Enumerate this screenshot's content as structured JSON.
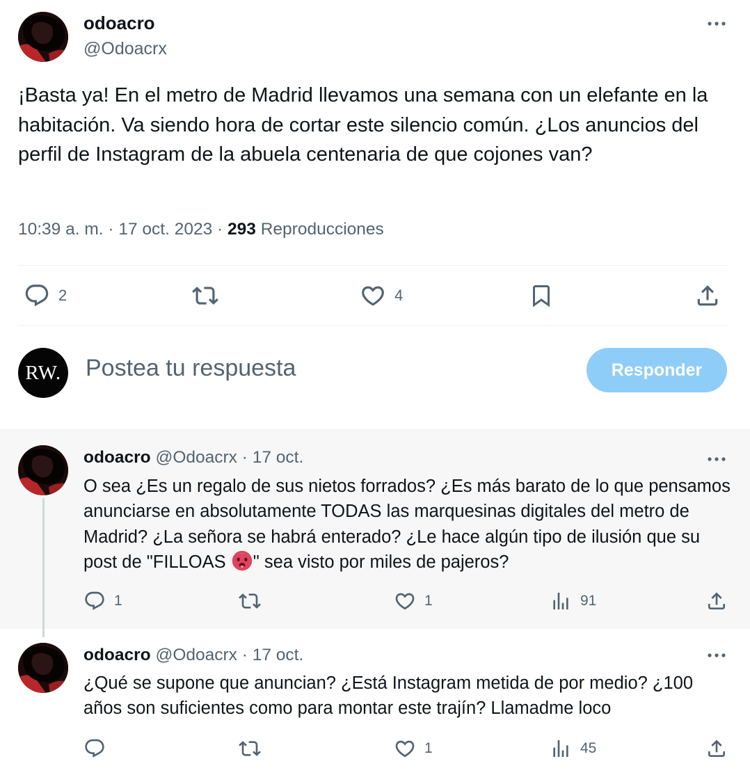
{
  "main_post": {
    "author_name": "odoacro",
    "handle": "@Odoacrx",
    "text": "¡Basta ya! En el metro de Madrid llevamos una semana con un elefante en la habitación. Va siendo hora de cortar este silencio común. ¿Los anuncios del perfil de Instagram de la abuela centenaria de que cojones van?",
    "time": "10:39 a. m.",
    "separator": "·",
    "date": "17 oct. 2023",
    "views_count": "293",
    "views_label": "Reproducciones",
    "replies": "2",
    "likes": "4"
  },
  "compose": {
    "avatar_text": "RW.",
    "placeholder": "Postea tu respuesta",
    "button_label": "Responder"
  },
  "replies": [
    {
      "author_name": "odoacro",
      "handle": "@Odoacrx",
      "separator": "·",
      "date": "17 oct.",
      "text_before_emoji": "O sea ¿Es un regalo de sus nietos forrados? ¿Es más barato de lo que pensamos anunciarse en absolutamente TODAS las marquesinas digitales del metro de Madrid? ¿La señora se habrá enterado? ¿Le hace algún tipo de ilusión que su post de \"FILLOAS ",
      "emoji": "hot-face-emoji",
      "text_after_emoji": "\" sea visto por miles de pajeros?",
      "replies": "1",
      "likes": "1",
      "views": "91"
    },
    {
      "author_name": "odoacro",
      "handle": "@Odoacrx",
      "separator": "·",
      "date": "17 oct.",
      "text": "¿Qué se supone que anuncian? ¿Está Instagram metida de por medio? ¿100 años son suficientes como para montar este trajín? Llamadme loco",
      "likes": "1",
      "views": "45"
    }
  ],
  "colors": {
    "text": "#0f1419",
    "muted": "#536471",
    "divider": "#eff3f4",
    "highlight_bg": "#f7f7f7",
    "thread_line": "#cfd9de",
    "button_disabled": "#8ecdf8"
  }
}
